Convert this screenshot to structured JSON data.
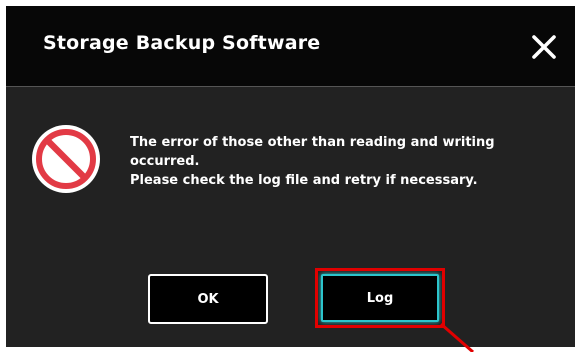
{
  "window": {
    "title": "Storage Backup Software",
    "close_icon": "close-icon"
  },
  "message": {
    "icon": "prohibited-icon",
    "line1": "The error of those other than reading and writing",
    "line2": "occurred.",
    "line3": "Please check the log file and retry if necessary."
  },
  "buttons": {
    "ok": "OK",
    "log": "Log"
  },
  "colors": {
    "dialog_background": "#222222",
    "titlebar_background": "#070707",
    "icon_red": "#e23a45",
    "focus_outline": "#2cc4cc",
    "annotation_red": "#e10000"
  }
}
